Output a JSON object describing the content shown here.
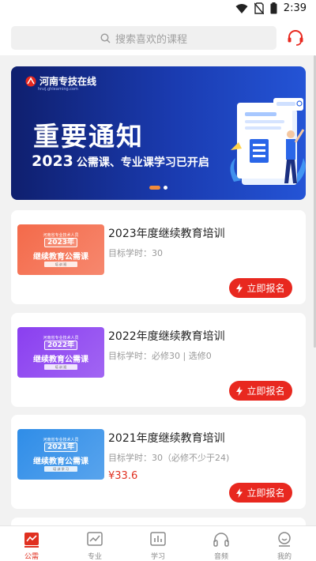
{
  "status": {
    "time": "2:39"
  },
  "search": {
    "placeholder": "搜索喜欢的课程"
  },
  "banner": {
    "brand": "河南专技在线",
    "brand_url": "hnzj.ghlearning.com",
    "title": "重要通知",
    "year": "2023",
    "subtitle": "公需课、专业课学习已开启"
  },
  "courses": [
    {
      "title": "2023年度继续教育培训",
      "hours": "目标学时：30",
      "price": "",
      "thumb_top": "河南省专业技术人员",
      "thumb_year": "2023年",
      "thumb_caption": "继续教育公需课",
      "thumb_foot": "培 训 班",
      "thumb_color": "#f46a4a",
      "button": "立即报名"
    },
    {
      "title": "2022年度继续教育培训",
      "hours": "目标学时：必修30 | 选修0",
      "price": "",
      "thumb_top": "河南省专业技术人员",
      "thumb_year": "2022年",
      "thumb_caption": "继续教育公需课",
      "thumb_foot": "培 训 班",
      "thumb_color": "#8a3ff0",
      "button": "立即报名"
    },
    {
      "title": "2021年度继续教育培训",
      "hours": "目标学时：30（必修不少于24)",
      "price": "¥33.6",
      "thumb_top": "河南省专业技术人员",
      "thumb_year": "2021年",
      "thumb_caption": "继续教育公需课",
      "thumb_foot": "培 训 学 习",
      "thumb_color": "#2f8de8",
      "button": "立即报名"
    }
  ],
  "tabs": [
    {
      "label": "公需",
      "icon": "gongxu-icon",
      "active": true
    },
    {
      "label": "专业",
      "icon": "chart-icon",
      "active": false
    },
    {
      "label": "学习",
      "icon": "bar-chart-icon",
      "active": false
    },
    {
      "label": "音频",
      "icon": "headphones-icon",
      "active": false
    },
    {
      "label": "我的",
      "icon": "profile-icon",
      "active": false
    }
  ],
  "colors": {
    "accent": "#e8281f",
    "banner": "#1a3bb0"
  }
}
